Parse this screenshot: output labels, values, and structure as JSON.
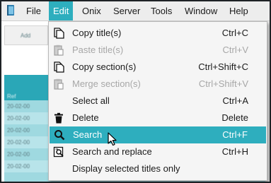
{
  "menubar": {
    "items": [
      {
        "label": "File"
      },
      {
        "label": "Edit",
        "active": true
      },
      {
        "label": "Onix"
      },
      {
        "label": "Server"
      },
      {
        "label": "Tools"
      },
      {
        "label": "Window"
      },
      {
        "label": "Help"
      }
    ]
  },
  "background": {
    "toolbar_text": "Add",
    "list_header": "Ref",
    "rows": [
      "20-02-00",
      "20-02-00",
      "20-02-00",
      "20-02-00",
      "20-02-00",
      "20-02-00"
    ]
  },
  "edit_menu": {
    "items": [
      {
        "label": "Copy title(s)",
        "shortcut": "Ctrl+C",
        "icon": "copy-icon",
        "enabled": true
      },
      {
        "label": "Paste title(s)",
        "shortcut": "Ctrl+V",
        "icon": "paste-icon",
        "enabled": false
      },
      {
        "label": "Copy section(s)",
        "shortcut": "Ctrl+Shift+C",
        "icon": "copy-icon",
        "enabled": true
      },
      {
        "label": "Merge section(s)",
        "shortcut": "Ctrl+Shift+V",
        "icon": "paste-icon",
        "enabled": false
      },
      {
        "label": "Select all",
        "shortcut": "Ctrl+A",
        "icon": "",
        "enabled": true
      },
      {
        "label": "Delete",
        "shortcut": "Delete",
        "icon": "trash-icon",
        "enabled": true
      },
      {
        "label": "Search",
        "shortcut": "Ctrl+F",
        "icon": "search-icon",
        "enabled": true,
        "highlighted": true
      },
      {
        "label": "Search and replace",
        "shortcut": "Ctrl+H",
        "icon": "search-replace-icon",
        "enabled": true
      },
      {
        "label": "Display selected titles only",
        "shortcut": "",
        "icon": "",
        "enabled": true
      }
    ]
  },
  "colors": {
    "accent": "#2eaebe",
    "menubar": "#ededed",
    "dropdown": "#f5f5f5",
    "disabled_text": "#a7a7a7"
  }
}
